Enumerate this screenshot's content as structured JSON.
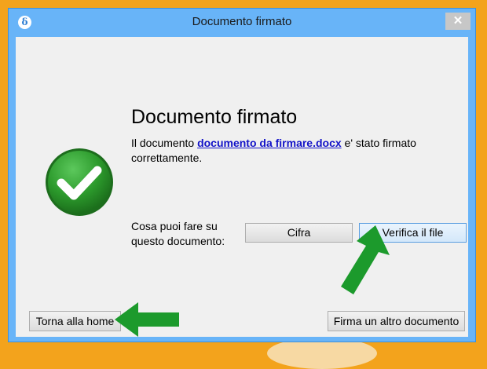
{
  "window": {
    "title": "Documento firmato",
    "app_icon_glyph": "δ",
    "close_glyph": "✕"
  },
  "content": {
    "heading": "Documento firmato",
    "message_prefix": "Il documento ",
    "document_link": "documento da firmare.docx",
    "message_suffix": " e' stato firmato correttamente.",
    "question": "Cosa puoi fare su questo documento:",
    "status_icon": "check-circle-icon"
  },
  "actions": {
    "cifra_label": "Cifra",
    "verifica_label": "Verifica il file",
    "home_label": "Torna alla home",
    "altro_label": "Firma un altro documento"
  },
  "annotations": {
    "arrow_color": "#1c9a2c",
    "arrow_icon": "green-arrow-icon"
  },
  "colors": {
    "desktop_bg": "#f3a31c",
    "titlebar": "#68b4f8",
    "success_green": "#2c9a2c",
    "link_blue": "#1313c8"
  }
}
